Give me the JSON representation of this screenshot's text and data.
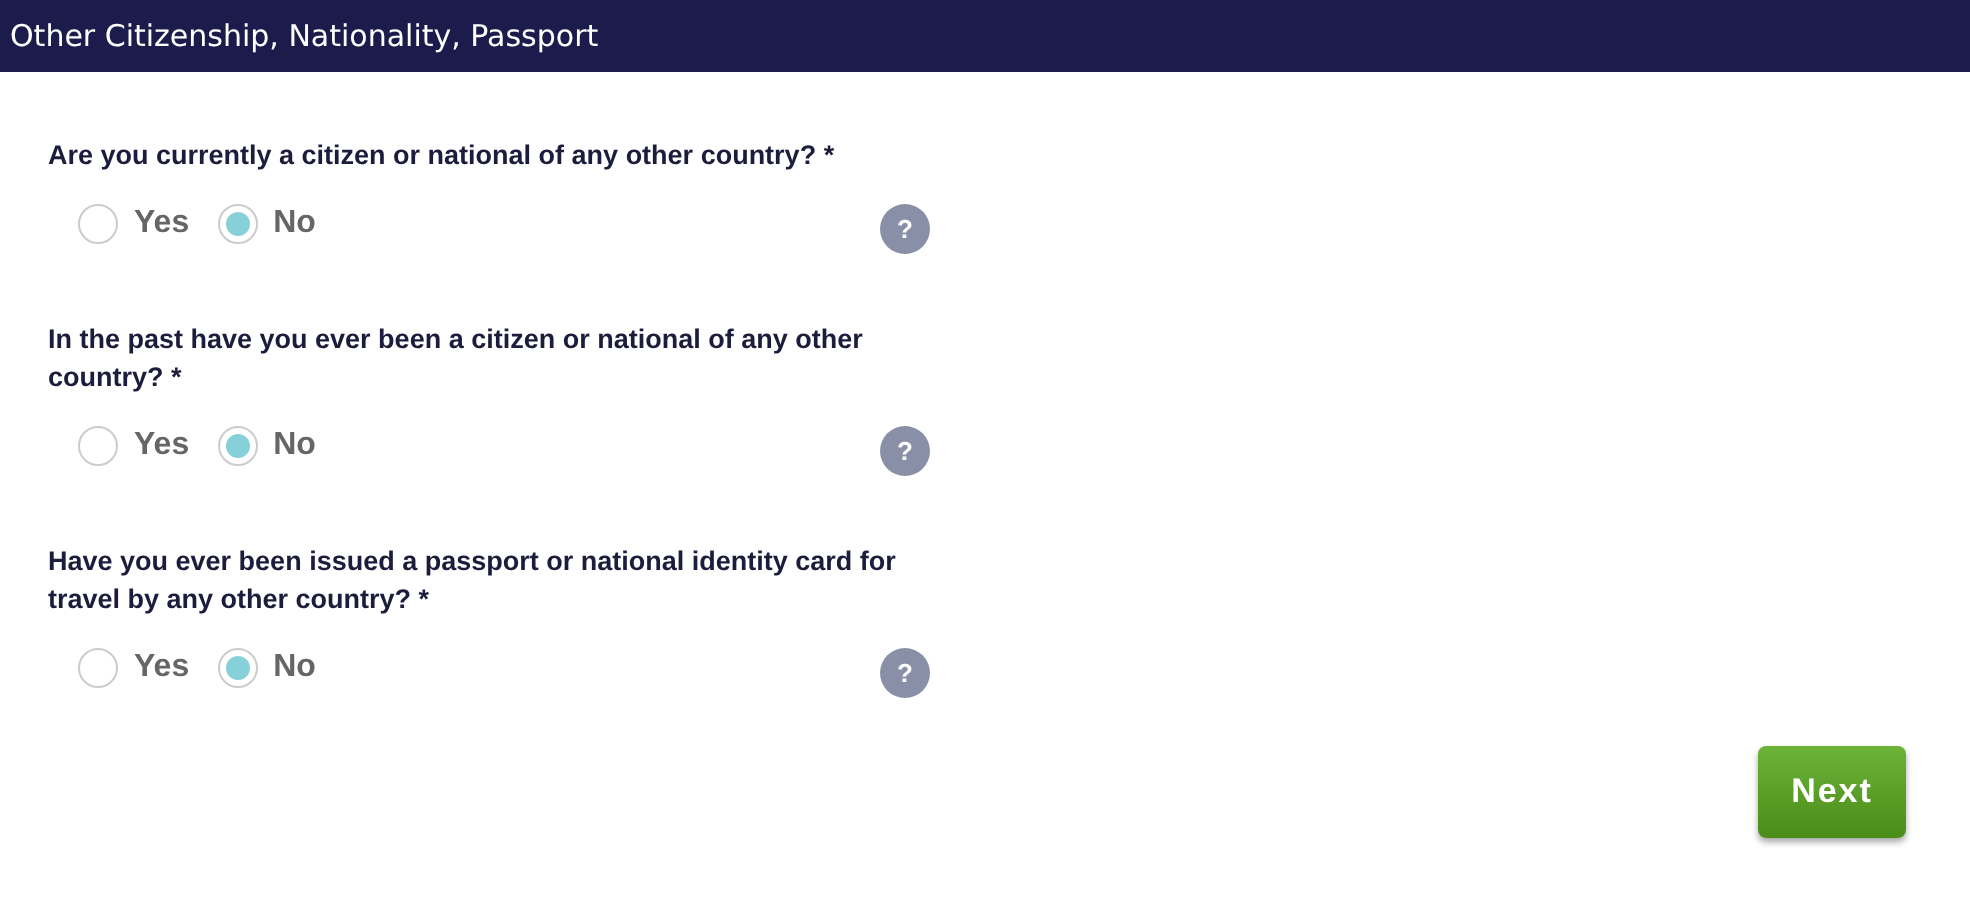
{
  "header": {
    "title": "Other Citizenship, Nationality, Passport"
  },
  "questions": [
    {
      "text": "Are you currently a citizen or national of any other country? *",
      "help": "?",
      "options": [
        {
          "label": "Yes",
          "selected": false
        },
        {
          "label": "No",
          "selected": true
        }
      ]
    },
    {
      "text": "In the past have you ever been a citizen or national of any other country? *",
      "help": "?",
      "options": [
        {
          "label": "Yes",
          "selected": false
        },
        {
          "label": "No",
          "selected": true
        }
      ]
    },
    {
      "text": "Have you ever been issued a passport or national identity card for travel by any other country? *",
      "help": "?",
      "options": [
        {
          "label": "Yes",
          "selected": false
        },
        {
          "label": "No",
          "selected": true
        }
      ]
    }
  ],
  "next_button": {
    "label": "Next"
  }
}
